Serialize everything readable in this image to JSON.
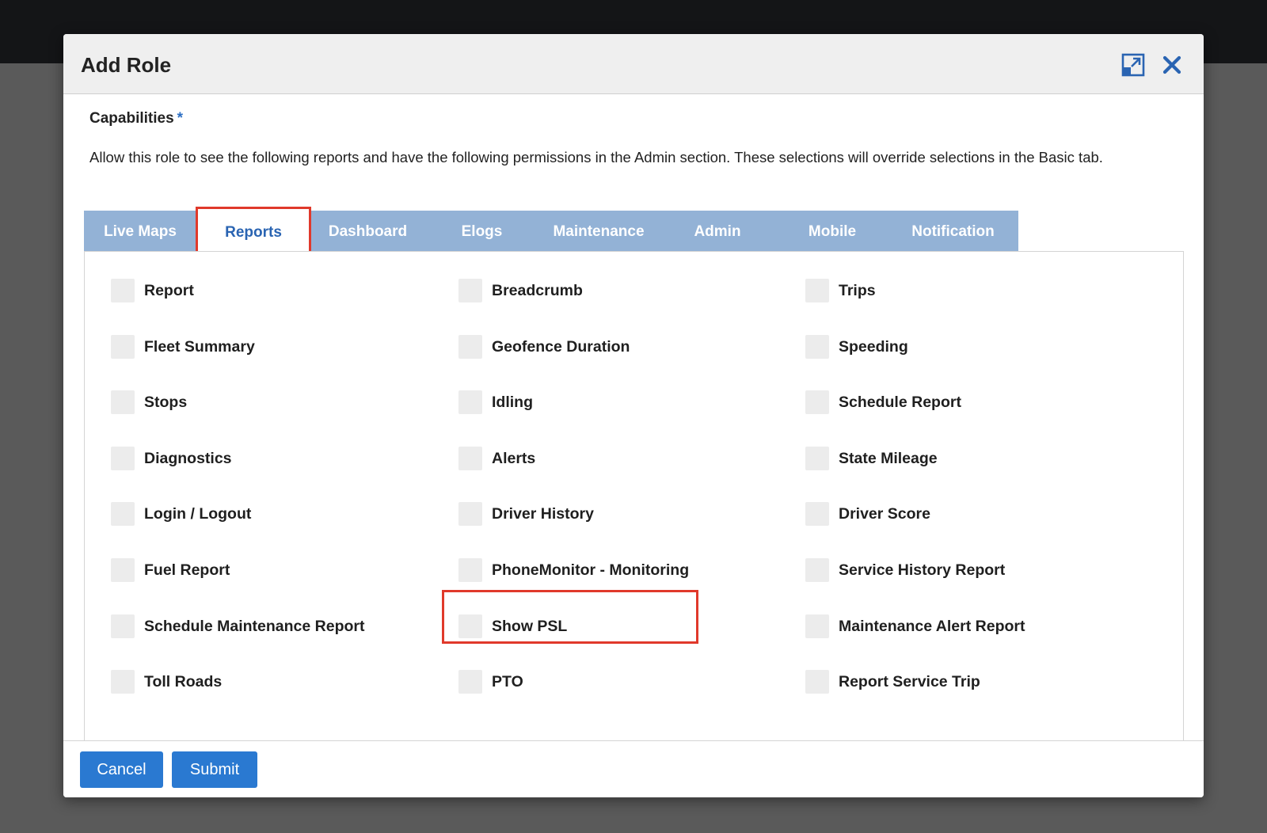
{
  "modal": {
    "title": "Add Role",
    "capabilities_label": "Capabilities",
    "required_mark": "*",
    "description": "Allow this role to see the following reports and have the following permissions in the Admin section. These selections will override selections in the Basic tab."
  },
  "tabs": [
    {
      "label": "Live Maps",
      "active": false
    },
    {
      "label": "Reports",
      "active": true
    },
    {
      "label": "Dashboard",
      "active": false
    },
    {
      "label": "Elogs",
      "active": false
    },
    {
      "label": "Maintenance",
      "active": false
    },
    {
      "label": "Admin",
      "active": false
    },
    {
      "label": "Mobile",
      "active": false
    },
    {
      "label": "Notification",
      "active": false
    }
  ],
  "options": [
    [
      {
        "label": "Report",
        "checked": false
      },
      {
        "label": "Breadcrumb",
        "checked": false
      },
      {
        "label": "Trips",
        "checked": false
      }
    ],
    [
      {
        "label": "Fleet Summary",
        "checked": false
      },
      {
        "label": "Geofence Duration",
        "checked": false
      },
      {
        "label": "Speeding",
        "checked": false
      }
    ],
    [
      {
        "label": "Stops",
        "checked": false
      },
      {
        "label": "Idling",
        "checked": false
      },
      {
        "label": "Schedule Report",
        "checked": false
      }
    ],
    [
      {
        "label": "Diagnostics",
        "checked": false
      },
      {
        "label": "Alerts",
        "checked": false
      },
      {
        "label": "State Mileage",
        "checked": false
      }
    ],
    [
      {
        "label": "Login / Logout",
        "checked": false
      },
      {
        "label": "Driver History",
        "checked": false
      },
      {
        "label": "Driver Score",
        "checked": false
      }
    ],
    [
      {
        "label": "Fuel Report",
        "checked": false
      },
      {
        "label": "PhoneMonitor - Monitoring",
        "checked": false
      },
      {
        "label": "Service History Report",
        "checked": false
      }
    ],
    [
      {
        "label": "Schedule Maintenance Report",
        "checked": false
      },
      {
        "label": "Show PSL",
        "checked": false
      },
      {
        "label": "Maintenance Alert Report",
        "checked": false
      }
    ],
    [
      {
        "label": "Toll Roads",
        "checked": false
      },
      {
        "label": "PTO",
        "checked": false
      },
      {
        "label": "Report Service Trip",
        "checked": false
      }
    ]
  ],
  "footer": {
    "cancel_label": "Cancel",
    "submit_label": "Submit"
  },
  "colors": {
    "accent": "#2a79d1",
    "tab_bar": "#93b2d6",
    "highlight": "#e0392b"
  },
  "icons": {
    "expand": "expand-icon",
    "close": "close-icon"
  }
}
